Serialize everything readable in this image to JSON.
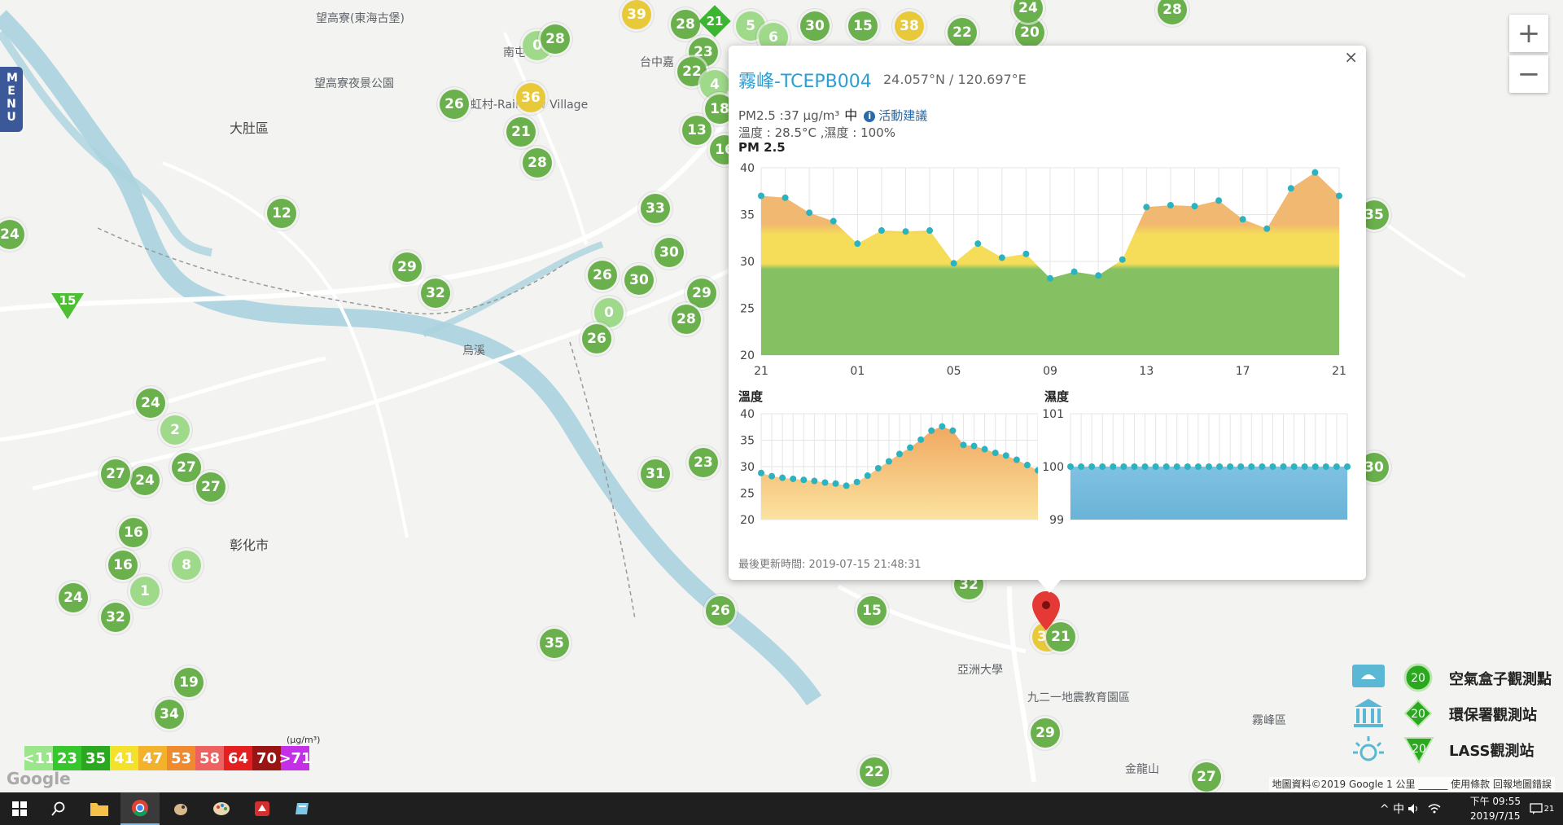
{
  "menu": {
    "label": "MENU"
  },
  "zoom": {
    "in_label": "+",
    "out_label": "−"
  },
  "map_labels": [
    "望高寮(東海古堡)",
    "望高寮夜景公園",
    "大肚區",
    "彰化市",
    "亞洲大學",
    "霧峰區",
    "九二一地震教育園區",
    "南屯",
    "台中嘉",
    "虹村-Rainbow Village",
    "金龍山",
    "烏溪"
  ],
  "markers": [
    {
      "v": "39",
      "c": "y"
    },
    {
      "v": "28",
      "c": "g1"
    },
    {
      "v": "21",
      "c": "g1"
    },
    {
      "v": "5",
      "c": "lg"
    },
    {
      "v": "30",
      "c": "g1"
    },
    {
      "v": "15",
      "c": "g1"
    },
    {
      "v": "38",
      "c": "y"
    },
    {
      "v": "22",
      "c": "g1"
    },
    {
      "v": "20",
      "c": "g1"
    },
    {
      "v": "24",
      "c": "g1"
    },
    {
      "v": "28",
      "c": "g1"
    },
    {
      "v": "0",
      "c": "lg"
    },
    {
      "v": "28",
      "c": "g1"
    },
    {
      "v": "23",
      "c": "g1"
    },
    {
      "v": "6",
      "c": "lg"
    },
    {
      "v": "22",
      "c": "g1"
    },
    {
      "v": "4",
      "c": "lg"
    },
    {
      "v": "36",
      "c": "y"
    },
    {
      "v": "26",
      "c": "g1"
    },
    {
      "v": "21",
      "c": "g1"
    },
    {
      "v": "28",
      "c": "g1"
    },
    {
      "v": "13",
      "c": "g1"
    },
    {
      "v": "18",
      "c": "g1"
    },
    {
      "v": "16",
      "c": "g1"
    },
    {
      "v": "33",
      "c": "g1"
    },
    {
      "v": "12",
      "c": "g1"
    },
    {
      "v": "24",
      "c": "g1"
    },
    {
      "v": "29",
      "c": "g1"
    },
    {
      "v": "32",
      "c": "g1"
    },
    {
      "v": "26",
      "c": "g1"
    },
    {
      "v": "30",
      "c": "g1"
    },
    {
      "v": "30",
      "c": "g1"
    },
    {
      "v": "29",
      "c": "g1"
    },
    {
      "v": "28",
      "c": "g1"
    },
    {
      "v": "0",
      "c": "lg"
    },
    {
      "v": "26",
      "c": "g1"
    },
    {
      "v": "24",
      "c": "g1"
    },
    {
      "v": "2",
      "c": "lg"
    },
    {
      "v": "27",
      "c": "g1"
    },
    {
      "v": "24",
      "c": "g1"
    },
    {
      "v": "27",
      "c": "g1"
    },
    {
      "v": "27",
      "c": "g1"
    },
    {
      "v": "16",
      "c": "g1"
    },
    {
      "v": "16",
      "c": "g1"
    },
    {
      "v": "8",
      "c": "lg"
    },
    {
      "v": "1",
      "c": "lg"
    },
    {
      "v": "24",
      "c": "g1"
    },
    {
      "v": "32",
      "c": "g1"
    },
    {
      "v": "31",
      "c": "g1"
    },
    {
      "v": "23",
      "c": "g1"
    },
    {
      "v": "26",
      "c": "g1"
    },
    {
      "v": "15",
      "c": "g1"
    },
    {
      "v": "32",
      "c": "g1"
    },
    {
      "v": "35",
      "c": "g1"
    },
    {
      "v": "19",
      "c": "g1"
    },
    {
      "v": "34",
      "c": "g1"
    },
    {
      "v": "29",
      "c": "g1"
    },
    {
      "v": "22",
      "c": "g1"
    },
    {
      "v": "27",
      "c": "g1"
    },
    {
      "v": "35",
      "c": "g1"
    },
    {
      "v": "30",
      "c": "g1"
    },
    {
      "v": "37",
      "c": "y"
    },
    {
      "v": "21",
      "c": "g1"
    }
  ],
  "triangles": [
    "15"
  ],
  "diamonds": [
    "21"
  ],
  "popup": {
    "close_label": "×",
    "title": "霧峰-TCEPB004",
    "coords": "24.057°N / 120.697°E",
    "pm_line": "PM2.5 :37 μg/m³",
    "pm_level": "中",
    "info_icon": "i",
    "advice_link": "活動建議",
    "temp_line": "溫度 : 28.5°C ,濕度 : 100%",
    "pm_header": "PM 2.5",
    "temp_header": "溫度",
    "hum_header": "濕度",
    "updated": "最後更新時間: 2019-07-15 21:48:31"
  },
  "chart_data": [
    {
      "type": "area",
      "title": "PM 2.5",
      "x": [
        "21",
        "22",
        "23",
        "00",
        "01",
        "02",
        "03",
        "04",
        "05",
        "06",
        "07",
        "08",
        "09",
        "10",
        "11",
        "12",
        "13",
        "14",
        "15",
        "16",
        "17",
        "18",
        "19",
        "20",
        "21"
      ],
      "xticks": [
        "21",
        "01",
        "05",
        "09",
        "13",
        "17",
        "21"
      ],
      "series": [
        {
          "values": [
            37,
            36.8,
            35.2,
            34.3,
            31.9,
            33.3,
            33.2,
            33.3,
            29.8,
            31.9,
            30.4,
            30.8,
            28.2,
            28.9,
            28.5,
            30.2,
            35.8,
            36,
            35.9,
            36.5,
            34.5,
            33.5,
            37.8,
            39.5,
            37
          ]
        }
      ],
      "ylim": [
        20,
        40
      ],
      "yticks": [
        20,
        25,
        30,
        35,
        40
      ],
      "band_colors": {
        "low": "#85c062",
        "mid": "#f5dd59",
        "high": "#f0b870"
      }
    },
    {
      "type": "area",
      "title": "溫度",
      "series": [
        {
          "values": [
            28.8,
            28.2,
            27.9,
            27.7,
            27.5,
            27.3,
            27,
            26.8,
            26.4,
            27.1,
            28.3,
            29.7,
            31,
            32.4,
            33.6,
            35.1,
            36.8,
            37.6,
            36.8,
            34.1,
            33.9,
            33.3,
            32.6,
            32.1,
            31.3,
            30.3,
            29.3
          ]
        }
      ],
      "ylim": [
        20,
        40
      ],
      "yticks": [
        20,
        25,
        30,
        35,
        40
      ]
    },
    {
      "type": "area",
      "title": "濕度",
      "series": [
        {
          "values": [
            100,
            100,
            100,
            100,
            100,
            100,
            100,
            100,
            100,
            100,
            100,
            100,
            100,
            100,
            100,
            100,
            100,
            100,
            100,
            100,
            100,
            100,
            100,
            100,
            100,
            100,
            100
          ]
        }
      ],
      "ylim": [
        99,
        101
      ],
      "yticks": [
        99,
        100,
        101
      ]
    }
  ],
  "scale": {
    "unit": "(μg/m³)",
    "cells": [
      {
        "label": "<11",
        "color": "#9be58b"
      },
      {
        "label": "23",
        "color": "#35c72c"
      },
      {
        "label": "35",
        "color": "#2aa81f"
      },
      {
        "label": "41",
        "color": "#f3e12b"
      },
      {
        "label": "47",
        "color": "#f3b22b"
      },
      {
        "label": "53",
        "color": "#ef8a2f"
      },
      {
        "label": "58",
        "color": "#ee6161"
      },
      {
        "label": "64",
        "color": "#e31f1f"
      },
      {
        "label": "70",
        "color": "#9b1414"
      },
      {
        "label": ">71",
        "color": "#c430e8"
      }
    ]
  },
  "legend": [
    {
      "label": "空氣盒子觀測點",
      "badge": "20",
      "icon": "airbox-icon"
    },
    {
      "label": "環保署觀測站",
      "badge": "20",
      "icon": "government-building-icon"
    },
    {
      "label": "LASS觀測站",
      "badge": "20",
      "icon": "sun-icon"
    }
  ],
  "google": "Google",
  "attribution": "地圖資料©2019 Google   1 公里 ______   使用條款   回報地圖錯誤",
  "taskbar": {
    "time": "下午 09:55",
    "date": "2019/7/15",
    "tray": "^ 中 ",
    "notify_count": "21"
  }
}
